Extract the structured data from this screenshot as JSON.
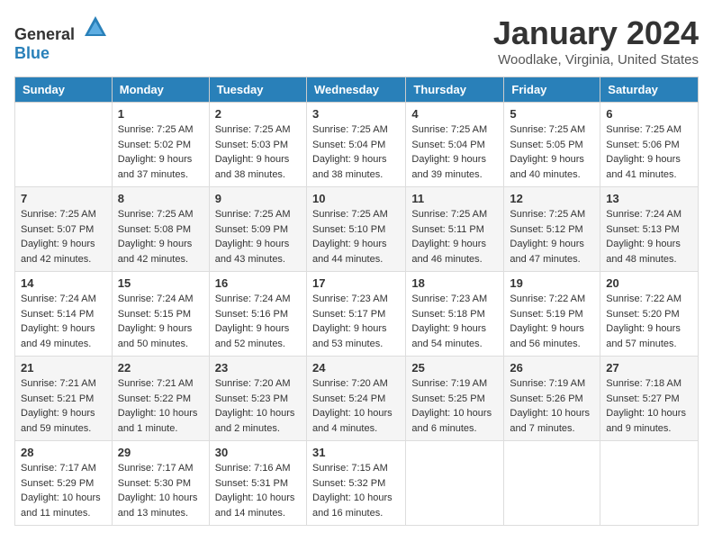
{
  "header": {
    "logo": {
      "text_general": "General",
      "text_blue": "Blue"
    },
    "month_title": "January 2024",
    "location": "Woodlake, Virginia, United States"
  },
  "weekdays": [
    "Sunday",
    "Monday",
    "Tuesday",
    "Wednesday",
    "Thursday",
    "Friday",
    "Saturday"
  ],
  "weeks": [
    [
      {
        "day": "",
        "sunrise": "",
        "sunset": "",
        "daylight": ""
      },
      {
        "day": "1",
        "sunrise": "Sunrise: 7:25 AM",
        "sunset": "Sunset: 5:02 PM",
        "daylight": "Daylight: 9 hours and 37 minutes."
      },
      {
        "day": "2",
        "sunrise": "Sunrise: 7:25 AM",
        "sunset": "Sunset: 5:03 PM",
        "daylight": "Daylight: 9 hours and 38 minutes."
      },
      {
        "day": "3",
        "sunrise": "Sunrise: 7:25 AM",
        "sunset": "Sunset: 5:04 PM",
        "daylight": "Daylight: 9 hours and 38 minutes."
      },
      {
        "day": "4",
        "sunrise": "Sunrise: 7:25 AM",
        "sunset": "Sunset: 5:04 PM",
        "daylight": "Daylight: 9 hours and 39 minutes."
      },
      {
        "day": "5",
        "sunrise": "Sunrise: 7:25 AM",
        "sunset": "Sunset: 5:05 PM",
        "daylight": "Daylight: 9 hours and 40 minutes."
      },
      {
        "day": "6",
        "sunrise": "Sunrise: 7:25 AM",
        "sunset": "Sunset: 5:06 PM",
        "daylight": "Daylight: 9 hours and 41 minutes."
      }
    ],
    [
      {
        "day": "7",
        "sunrise": "Sunrise: 7:25 AM",
        "sunset": "Sunset: 5:07 PM",
        "daylight": "Daylight: 9 hours and 42 minutes."
      },
      {
        "day": "8",
        "sunrise": "Sunrise: 7:25 AM",
        "sunset": "Sunset: 5:08 PM",
        "daylight": "Daylight: 9 hours and 42 minutes."
      },
      {
        "day": "9",
        "sunrise": "Sunrise: 7:25 AM",
        "sunset": "Sunset: 5:09 PM",
        "daylight": "Daylight: 9 hours and 43 minutes."
      },
      {
        "day": "10",
        "sunrise": "Sunrise: 7:25 AM",
        "sunset": "Sunset: 5:10 PM",
        "daylight": "Daylight: 9 hours and 44 minutes."
      },
      {
        "day": "11",
        "sunrise": "Sunrise: 7:25 AM",
        "sunset": "Sunset: 5:11 PM",
        "daylight": "Daylight: 9 hours and 46 minutes."
      },
      {
        "day": "12",
        "sunrise": "Sunrise: 7:25 AM",
        "sunset": "Sunset: 5:12 PM",
        "daylight": "Daylight: 9 hours and 47 minutes."
      },
      {
        "day": "13",
        "sunrise": "Sunrise: 7:24 AM",
        "sunset": "Sunset: 5:13 PM",
        "daylight": "Daylight: 9 hours and 48 minutes."
      }
    ],
    [
      {
        "day": "14",
        "sunrise": "Sunrise: 7:24 AM",
        "sunset": "Sunset: 5:14 PM",
        "daylight": "Daylight: 9 hours and 49 minutes."
      },
      {
        "day": "15",
        "sunrise": "Sunrise: 7:24 AM",
        "sunset": "Sunset: 5:15 PM",
        "daylight": "Daylight: 9 hours and 50 minutes."
      },
      {
        "day": "16",
        "sunrise": "Sunrise: 7:24 AM",
        "sunset": "Sunset: 5:16 PM",
        "daylight": "Daylight: 9 hours and 52 minutes."
      },
      {
        "day": "17",
        "sunrise": "Sunrise: 7:23 AM",
        "sunset": "Sunset: 5:17 PM",
        "daylight": "Daylight: 9 hours and 53 minutes."
      },
      {
        "day": "18",
        "sunrise": "Sunrise: 7:23 AM",
        "sunset": "Sunset: 5:18 PM",
        "daylight": "Daylight: 9 hours and 54 minutes."
      },
      {
        "day": "19",
        "sunrise": "Sunrise: 7:22 AM",
        "sunset": "Sunset: 5:19 PM",
        "daylight": "Daylight: 9 hours and 56 minutes."
      },
      {
        "day": "20",
        "sunrise": "Sunrise: 7:22 AM",
        "sunset": "Sunset: 5:20 PM",
        "daylight": "Daylight: 9 hours and 57 minutes."
      }
    ],
    [
      {
        "day": "21",
        "sunrise": "Sunrise: 7:21 AM",
        "sunset": "Sunset: 5:21 PM",
        "daylight": "Daylight: 9 hours and 59 minutes."
      },
      {
        "day": "22",
        "sunrise": "Sunrise: 7:21 AM",
        "sunset": "Sunset: 5:22 PM",
        "daylight": "Daylight: 10 hours and 1 minute."
      },
      {
        "day": "23",
        "sunrise": "Sunrise: 7:20 AM",
        "sunset": "Sunset: 5:23 PM",
        "daylight": "Daylight: 10 hours and 2 minutes."
      },
      {
        "day": "24",
        "sunrise": "Sunrise: 7:20 AM",
        "sunset": "Sunset: 5:24 PM",
        "daylight": "Daylight: 10 hours and 4 minutes."
      },
      {
        "day": "25",
        "sunrise": "Sunrise: 7:19 AM",
        "sunset": "Sunset: 5:25 PM",
        "daylight": "Daylight: 10 hours and 6 minutes."
      },
      {
        "day": "26",
        "sunrise": "Sunrise: 7:19 AM",
        "sunset": "Sunset: 5:26 PM",
        "daylight": "Daylight: 10 hours and 7 minutes."
      },
      {
        "day": "27",
        "sunrise": "Sunrise: 7:18 AM",
        "sunset": "Sunset: 5:27 PM",
        "daylight": "Daylight: 10 hours and 9 minutes."
      }
    ],
    [
      {
        "day": "28",
        "sunrise": "Sunrise: 7:17 AM",
        "sunset": "Sunset: 5:29 PM",
        "daylight": "Daylight: 10 hours and 11 minutes."
      },
      {
        "day": "29",
        "sunrise": "Sunrise: 7:17 AM",
        "sunset": "Sunset: 5:30 PM",
        "daylight": "Daylight: 10 hours and 13 minutes."
      },
      {
        "day": "30",
        "sunrise": "Sunrise: 7:16 AM",
        "sunset": "Sunset: 5:31 PM",
        "daylight": "Daylight: 10 hours and 14 minutes."
      },
      {
        "day": "31",
        "sunrise": "Sunrise: 7:15 AM",
        "sunset": "Sunset: 5:32 PM",
        "daylight": "Daylight: 10 hours and 16 minutes."
      },
      {
        "day": "",
        "sunrise": "",
        "sunset": "",
        "daylight": ""
      },
      {
        "day": "",
        "sunrise": "",
        "sunset": "",
        "daylight": ""
      },
      {
        "day": "",
        "sunrise": "",
        "sunset": "",
        "daylight": ""
      }
    ]
  ]
}
